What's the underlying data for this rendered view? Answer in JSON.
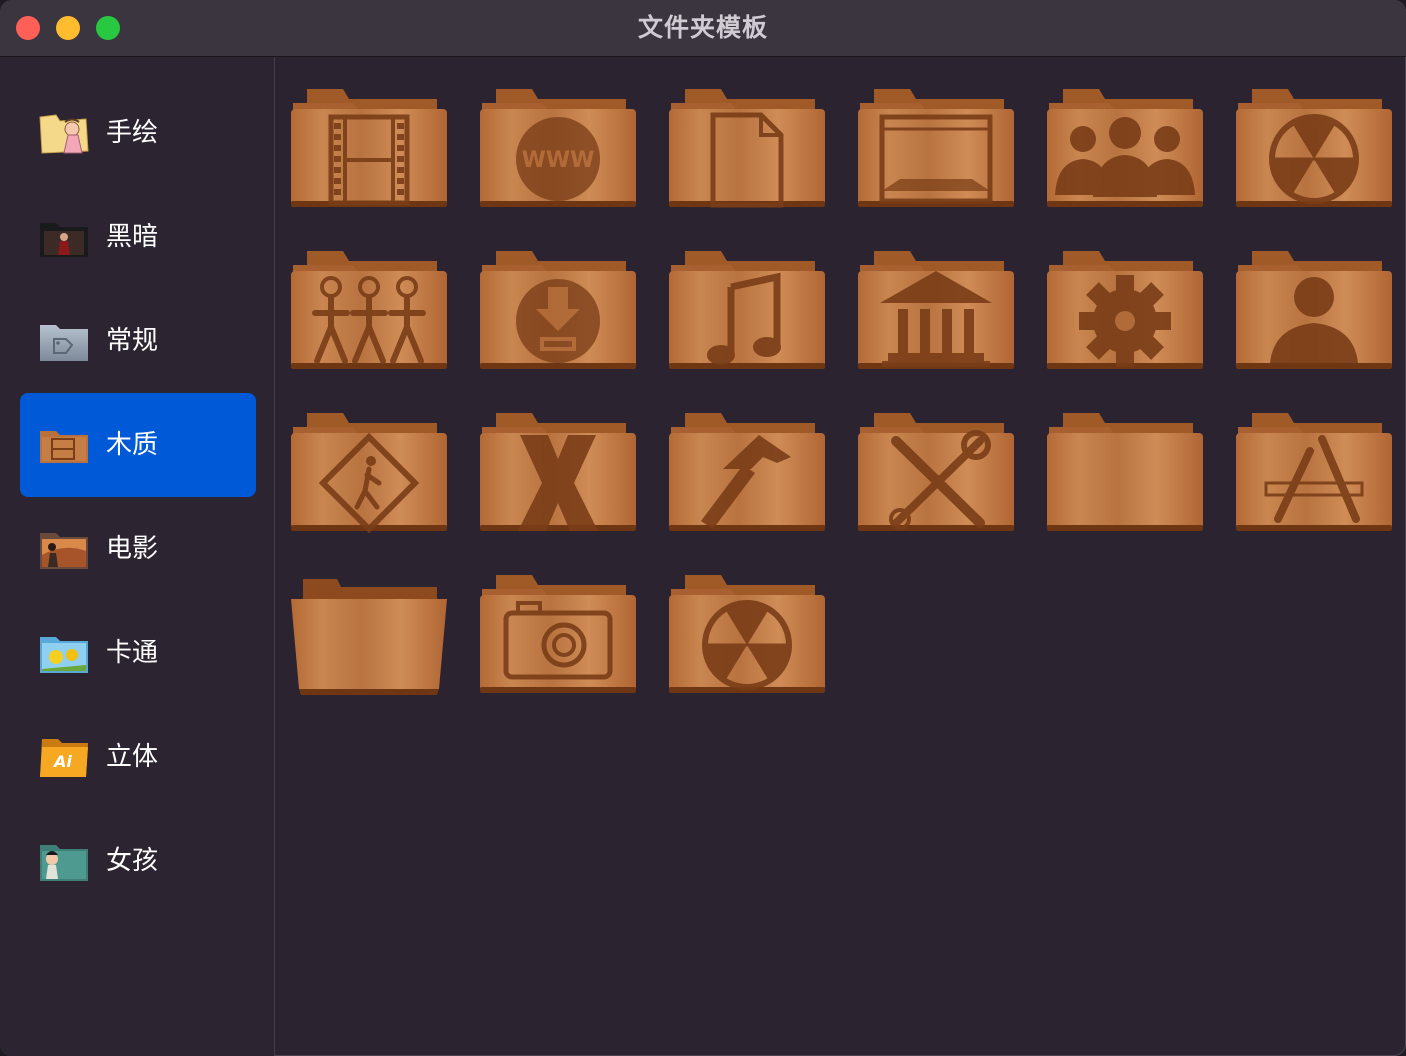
{
  "window": {
    "title": "文件夹模板"
  },
  "colors": {
    "background": "#2c2331",
    "titlebar": "#3a353e",
    "sidebar": "#2d2431",
    "selection": "#0059d6",
    "wood_light": "#c57e45",
    "wood_dark": "#8d4a1e",
    "engrave": "#7a3d17"
  },
  "sidebar": {
    "items": [
      {
        "label": "手绘",
        "icon": "hand-drawn-folder-icon",
        "selected": false
      },
      {
        "label": "黑暗",
        "icon": "dark-folder-icon",
        "selected": false
      },
      {
        "label": "常规",
        "icon": "standard-tag-folder-icon",
        "selected": false
      },
      {
        "label": "木质",
        "icon": "wood-film-folder-icon",
        "selected": true
      },
      {
        "label": "电影",
        "icon": "movie-folder-icon",
        "selected": false
      },
      {
        "label": "卡通",
        "icon": "cartoon-folder-icon",
        "selected": false
      },
      {
        "label": "立体",
        "icon": "3d-ai-folder-icon",
        "selected": false
      },
      {
        "label": "女孩",
        "icon": "girl-folder-icon",
        "selected": false
      }
    ]
  },
  "folders": [
    {
      "icon": "film-strip-icon"
    },
    {
      "icon": "www-globe-icon"
    },
    {
      "icon": "document-icon"
    },
    {
      "icon": "browser-window-icon"
    },
    {
      "icon": "users-group-icon"
    },
    {
      "icon": "burn-icon"
    },
    {
      "icon": "public-people-icon"
    },
    {
      "icon": "download-icon"
    },
    {
      "icon": "music-note-icon"
    },
    {
      "icon": "library-building-icon"
    },
    {
      "icon": "gear-icon"
    },
    {
      "icon": "user-silhouette-icon"
    },
    {
      "icon": "pedestrian-sign-icon"
    },
    {
      "icon": "x-letter-icon"
    },
    {
      "icon": "hammer-icon"
    },
    {
      "icon": "tools-icon"
    },
    {
      "icon": "plain-folder-icon"
    },
    {
      "icon": "applications-icon"
    },
    {
      "icon": "open-folder-icon"
    },
    {
      "icon": "camera-icon"
    },
    {
      "icon": "burn-icon"
    }
  ]
}
